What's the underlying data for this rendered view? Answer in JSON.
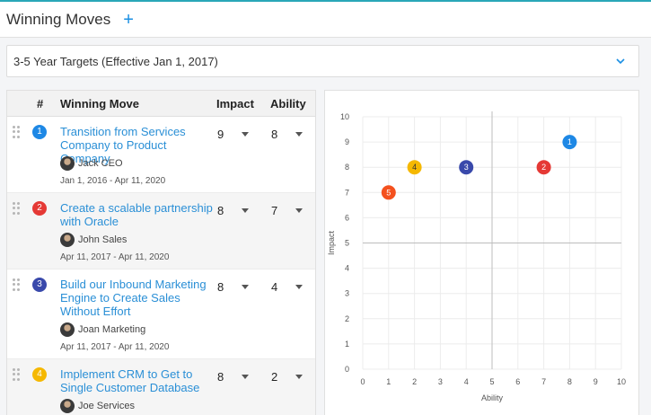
{
  "header": {
    "title": "Winning Moves",
    "add_label": "+"
  },
  "target_select": {
    "value": "3-5 Year Targets (Effective Jan 1, 2017)"
  },
  "table": {
    "headers": {
      "num": "#",
      "move": "Winning Move",
      "impact": "Impact",
      "ability": "Ability"
    },
    "rows": [
      {
        "num": "1",
        "color": "#1e88e5",
        "title": "Transition from Services Company to Product Company",
        "owner": "Jack CEO",
        "dates": "Jan 1, 2016 - Apr 11, 2020",
        "impact": "9",
        "ability": "8"
      },
      {
        "num": "2",
        "color": "#e53935",
        "title": "Create a scalable partnership with Oracle",
        "owner": "John Sales",
        "dates": "Apr 11, 2017 - Apr 11, 2020",
        "impact": "8",
        "ability": "7"
      },
      {
        "num": "3",
        "color": "#3949ab",
        "title": "Build our Inbound Marketing Engine to Create Sales Without Effort",
        "owner": "Joan Marketing",
        "dates": "Apr 11, 2017 - Apr 11, 2020",
        "impact": "8",
        "ability": "4"
      },
      {
        "num": "4",
        "color": "#f5b800",
        "title": "Implement CRM to Get to Single Customer Database",
        "owner": "Joe Services",
        "dates": "",
        "impact": "8",
        "ability": "2"
      }
    ]
  },
  "chart_data": {
    "type": "scatter",
    "xlabel": "Ability",
    "ylabel": "Impact",
    "xlim": [
      0,
      10
    ],
    "ylim": [
      0,
      10
    ],
    "x_ticks": [
      "0",
      "1",
      "2",
      "3",
      "4",
      "5",
      "6",
      "7",
      "8",
      "9",
      "10"
    ],
    "y_ticks": [
      "0",
      "1",
      "2",
      "3",
      "4",
      "5",
      "6",
      "7",
      "8",
      "9",
      "10"
    ],
    "grid": true,
    "quadrant_lines": {
      "x": 5,
      "y": 5
    },
    "points": [
      {
        "label": "1",
        "x": 8,
        "y": 9,
        "color": "#1e88e5",
        "text_color": "#ffffff"
      },
      {
        "label": "2",
        "x": 7,
        "y": 8,
        "color": "#e53935",
        "text_color": "#ffffff"
      },
      {
        "label": "3",
        "x": 4,
        "y": 8,
        "color": "#3949ab",
        "text_color": "#ffffff"
      },
      {
        "label": "4",
        "x": 2,
        "y": 8,
        "color": "#f5b800",
        "text_color": "#333333"
      },
      {
        "label": "5",
        "x": 1,
        "y": 7,
        "color": "#f4511e",
        "text_color": "#ffffff"
      }
    ]
  }
}
